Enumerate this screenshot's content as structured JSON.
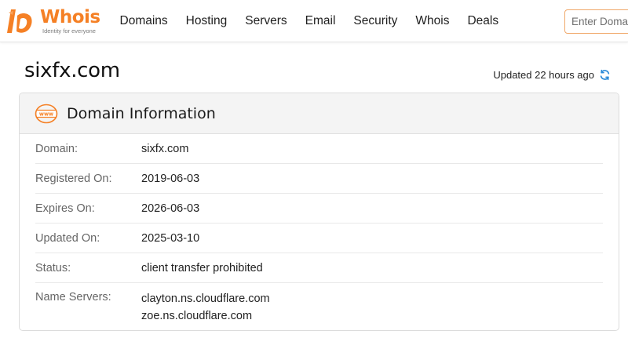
{
  "header": {
    "logo": {
      "word": "Whois",
      "tagline": "Identity for everyone"
    },
    "nav": [
      {
        "label": "Domains"
      },
      {
        "label": "Hosting"
      },
      {
        "label": "Servers"
      },
      {
        "label": "Email"
      },
      {
        "label": "Security"
      },
      {
        "label": "Whois"
      },
      {
        "label": "Deals"
      }
    ],
    "search": {
      "placeholder": "Enter Domain",
      "value": ""
    }
  },
  "page": {
    "title": "sixfx.com",
    "updated_text": "Updated 22 hours ago"
  },
  "card": {
    "icon_text": "www",
    "title": "Domain Information",
    "rows": [
      {
        "label": "Domain:",
        "value": "sixfx.com"
      },
      {
        "label": "Registered On:",
        "value": "2019-06-03"
      },
      {
        "label": "Expires On:",
        "value": "2026-06-03"
      },
      {
        "label": "Updated On:",
        "value": "2025-03-10"
      },
      {
        "label": "Status:",
        "value": "client transfer prohibited"
      }
    ],
    "name_servers": {
      "label": "Name Servers:",
      "values": [
        "clayton.ns.cloudflare.com",
        "zoe.ns.cloudflare.com"
      ]
    }
  },
  "icons": {
    "logo": "whois-logo-icon",
    "refresh": "refresh-icon",
    "www": "www-globe-icon"
  },
  "colors": {
    "brand_orange": "#f58025",
    "refresh_blue": "#2b8ad8",
    "card_header_bg": "#f4f4f4"
  }
}
